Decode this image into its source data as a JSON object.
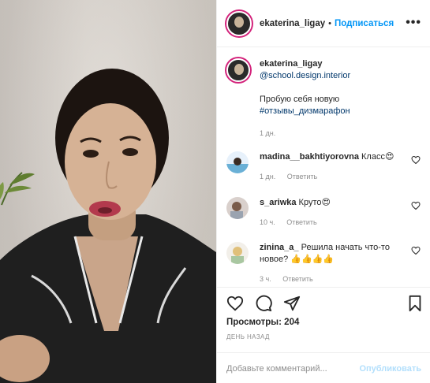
{
  "header": {
    "username": "ekaterina_ligay",
    "separator": "•",
    "follow_label": "Подписаться",
    "more_label": "•••"
  },
  "caption": {
    "username": "ekaterina_ligay",
    "mention": "@school.design.interior",
    "text": "Пробую себя новую",
    "hashtag": "#отзывы_дизмарафон",
    "time": "1 дн."
  },
  "comments": [
    {
      "username": "madina__bakhtiyorovna",
      "text": "Класс😍",
      "time": "1 дн.",
      "reply_label": "Ответить"
    },
    {
      "username": "s_ariwka",
      "text": "Круто😍",
      "time": "10 ч.",
      "reply_label": "Ответить"
    },
    {
      "username": "zinina_a_",
      "text": "Решила начать что-то новое? 👍👍👍👍",
      "time": "3 ч.",
      "reply_label": "Ответить"
    }
  ],
  "stats": {
    "views_label": "Просмотры:",
    "views_count": "204",
    "posted_ago": "день назад"
  },
  "add_comment": {
    "placeholder": "Добавьте комментарий...",
    "publish_label": "Опубликовать"
  },
  "colors": {
    "accent": "#0095f6",
    "link": "#00376b",
    "muted": "#8e8e8e",
    "publish_disabled": "#b2dffc",
    "story_ring": "#d3237b"
  }
}
